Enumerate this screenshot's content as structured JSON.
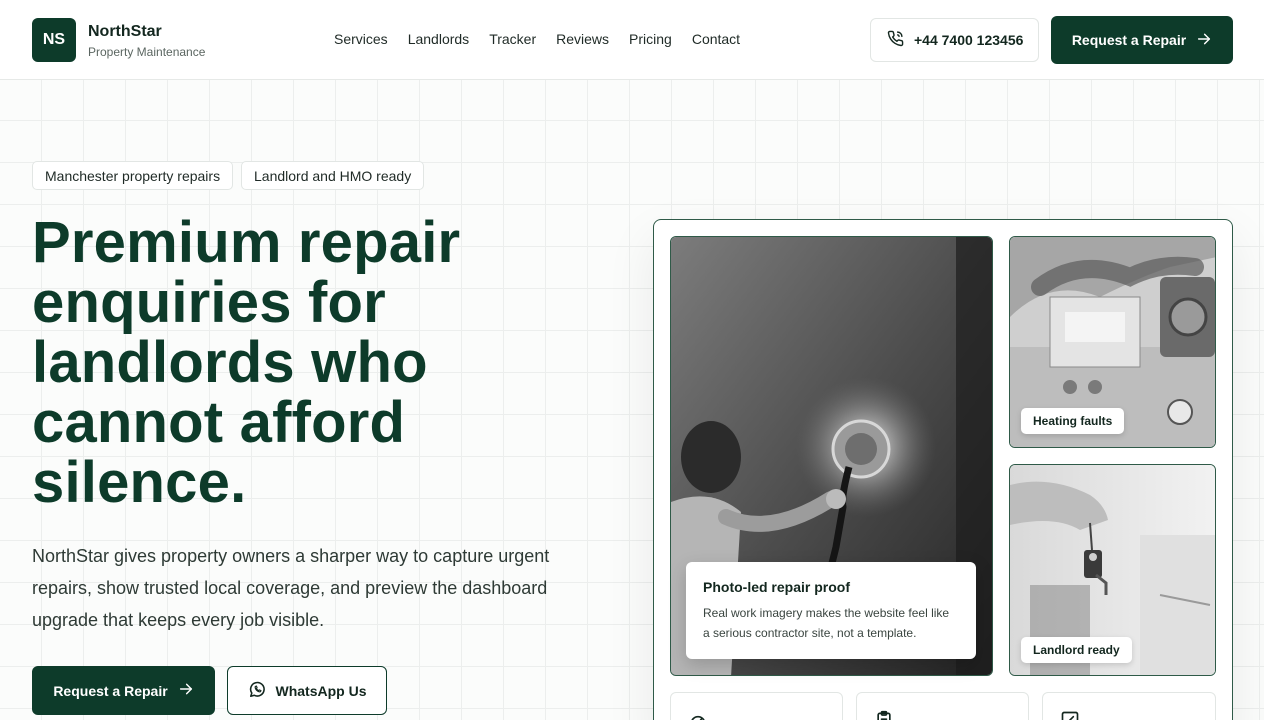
{
  "brand": {
    "logo_text": "NS",
    "name": "NorthStar",
    "tagline": "Property Maintenance"
  },
  "nav": {
    "items": [
      "Services",
      "Landlords",
      "Tracker",
      "Reviews",
      "Pricing",
      "Contact"
    ]
  },
  "header": {
    "phone": "+44 7400 123456",
    "cta_label": "Request a Repair"
  },
  "hero": {
    "pills": [
      "Manchester property repairs",
      "Landlord and HMO ready"
    ],
    "title": "Premium repair enquiries for landlords who cannot afford silence.",
    "description": "NorthStar gives property owners a sharper way to capture urgent repairs, show trusted local coverage, and preview the dashboard upgrade that keeps every job visible.",
    "primary_cta": "Request a Repair",
    "secondary_cta": "WhatsApp Us"
  },
  "showcase": {
    "proof_title": "Photo-led repair proof",
    "proof_text": "Real work imagery makes the website feel like a serious contractor site, not a template.",
    "tag_heating": "Heating faults",
    "tag_landlord": "Landlord ready"
  },
  "colors": {
    "brand_green": "#0d3b2a",
    "border_green": "#2f5a48",
    "grid_line": "#eceeed"
  },
  "icons": [
    "phone-icon",
    "arrow-right-icon",
    "whatsapp-icon",
    "gauge-icon",
    "clipboard-icon",
    "edit-icon"
  ]
}
